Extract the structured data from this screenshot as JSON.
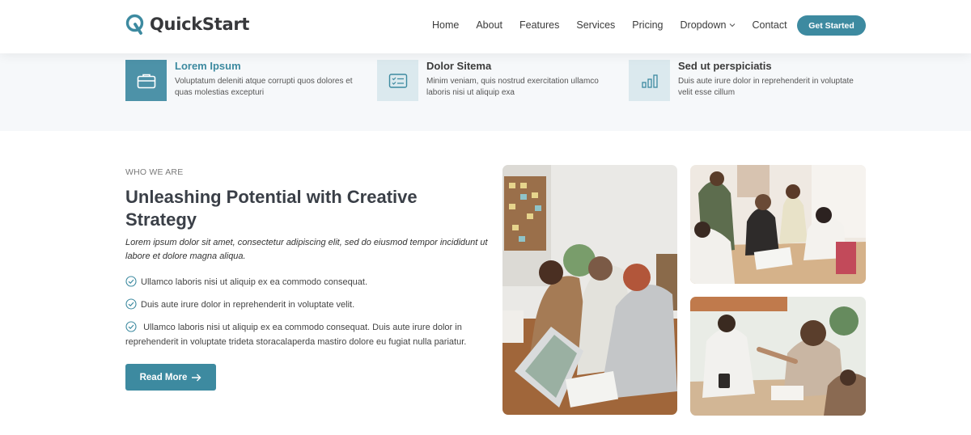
{
  "brand": {
    "name": "QuickStart",
    "accent": "#3d8aa0"
  },
  "nav": {
    "items": [
      "Home",
      "About",
      "Features",
      "Services",
      "Pricing",
      "Dropdown",
      "Contact"
    ],
    "cta": "Get Started"
  },
  "features": [
    {
      "icon": "briefcase-icon",
      "title": "Lorem Ipsum",
      "desc": "Voluptatum deleniti atque corrupti quos dolores et quas molestias excepturi"
    },
    {
      "icon": "card-checklist-icon",
      "title": "Dolor Sitema",
      "desc": "Minim veniam, quis nostrud exercitation ullamco laboris nisi ut aliquip exa"
    },
    {
      "icon": "bar-chart-icon",
      "title": "Sed ut perspiciatis",
      "desc": "Duis aute irure dolor in reprehenderit in voluptate velit esse cillum"
    }
  ],
  "about": {
    "eyebrow": "WHO WE ARE",
    "heading": "Unleashing Potential with Creative Strategy",
    "lead": "Lorem ipsum dolor sit amet, consectetur adipiscing elit, sed do eiusmod tempor incididunt ut labore et dolore magna aliqua.",
    "checks": [
      "Ullamco laboris nisi ut aliquip ex ea commodo consequat.",
      "Duis aute irure dolor in reprehenderit in voluptate velit.",
      "Ullamco laboris nisi ut aliquip ex ea commodo consequat. Duis aute irure dolor in reprehenderit in voluptate trideta storacalaperda mastiro dolore eu fugiat nulla pariatur."
    ],
    "button": "Read More"
  }
}
